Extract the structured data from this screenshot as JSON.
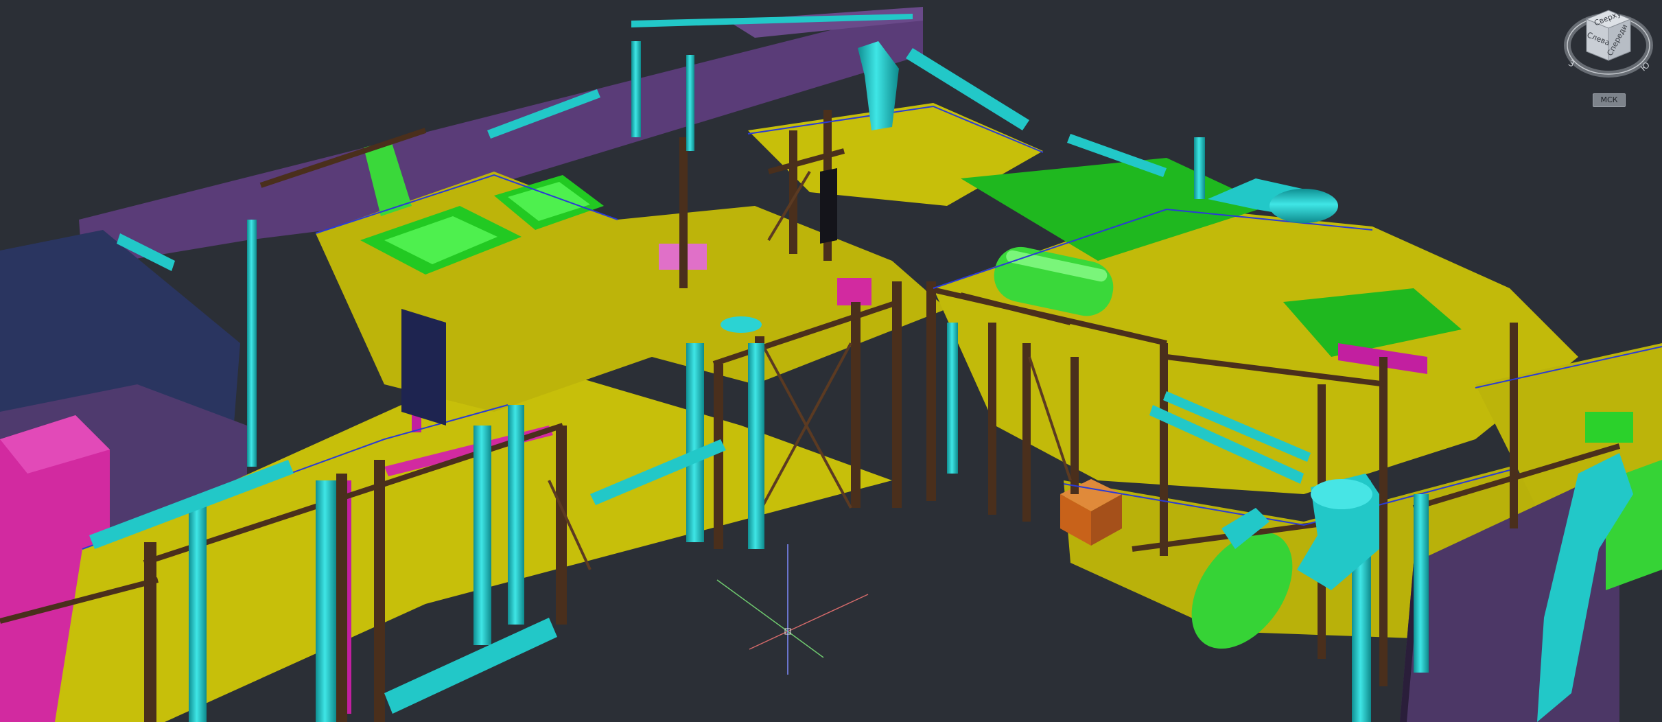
{
  "viewport": {
    "background": "#2b2f36",
    "content": "3D industrial plant model (steel structures, pipes, platforms)",
    "palette": {
      "structure_yellow": "#c7bf0a",
      "steel_brown": "#4a2f1c",
      "pipe_cyan": "#18c4c4",
      "equipment_green": "#2ee02e",
      "magenta": "#d22aa0",
      "purple_wall": "#5a3c78",
      "navy_wall": "#2a3560",
      "orange_box": "#c8621a",
      "railing_blue": "#2a3bd6"
    }
  },
  "viewcube": {
    "faces": [
      "Сверху",
      "Слева",
      "Спереди"
    ],
    "compass": [
      "Ю",
      "З"
    ],
    "wcs_label": "МСК"
  },
  "ucs_icon": {
    "axes": [
      "x",
      "y",
      "z"
    ],
    "colors": {
      "x": "#d46a6a",
      "y": "#6fc96f",
      "z": "#7f8cff"
    }
  }
}
